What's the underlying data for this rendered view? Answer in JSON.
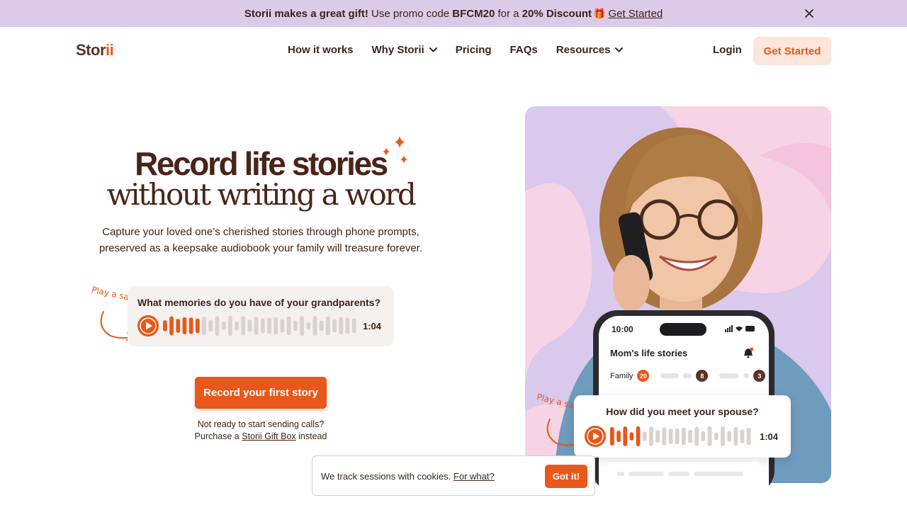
{
  "promo": {
    "bold_text": "Storii makes a great gift!",
    "text": "Use promo code",
    "code": "BFCM20",
    "mid_text": "for a",
    "discount": "20% Discount",
    "gift_icon": "🎁",
    "link": "Get Started"
  },
  "nav": {
    "logo_main": "Stor",
    "logo_accent": "ii",
    "items": [
      {
        "label": "How it works"
      },
      {
        "label": "Why Storii"
      },
      {
        "label": "Pricing"
      },
      {
        "label": "FAQs"
      },
      {
        "label": "Resources"
      }
    ],
    "login": "Login",
    "cta": "Get Started"
  },
  "hero": {
    "title_line1": "Record life stories",
    "title_line2": "without writing a word",
    "subtitle_line1": "Capture your loved one’s cherished stories through phone prompts,",
    "subtitle_line2": "preserved as a keepsake audiobook your family will treasure forever.",
    "sample_label": "Play a sample",
    "sample_question": "What memories do you have of your grandparents?",
    "sample_time": "1:04",
    "cta": "Record your first story",
    "note_line1": "Not ready to start sending calls?",
    "note_prefix": "Purchase a",
    "note_link": "Storii Gift Box",
    "note_suffix": "instead"
  },
  "phone": {
    "time": "10:00",
    "title": "Mom's life stories",
    "tag_label": "Family",
    "badges": [
      "20",
      "8",
      "3"
    ],
    "question": "How did you meet your spouse?",
    "audio_time": "1:04"
  },
  "cookie": {
    "text": "We track sessions with cookies.",
    "link": "For what?",
    "button": "Got it!"
  },
  "colors": {
    "accent": "#e8581a",
    "banner_bg": "#dccbe8",
    "text_brown": "#3b2418",
    "cta_soft_bg": "#fde6dc"
  }
}
